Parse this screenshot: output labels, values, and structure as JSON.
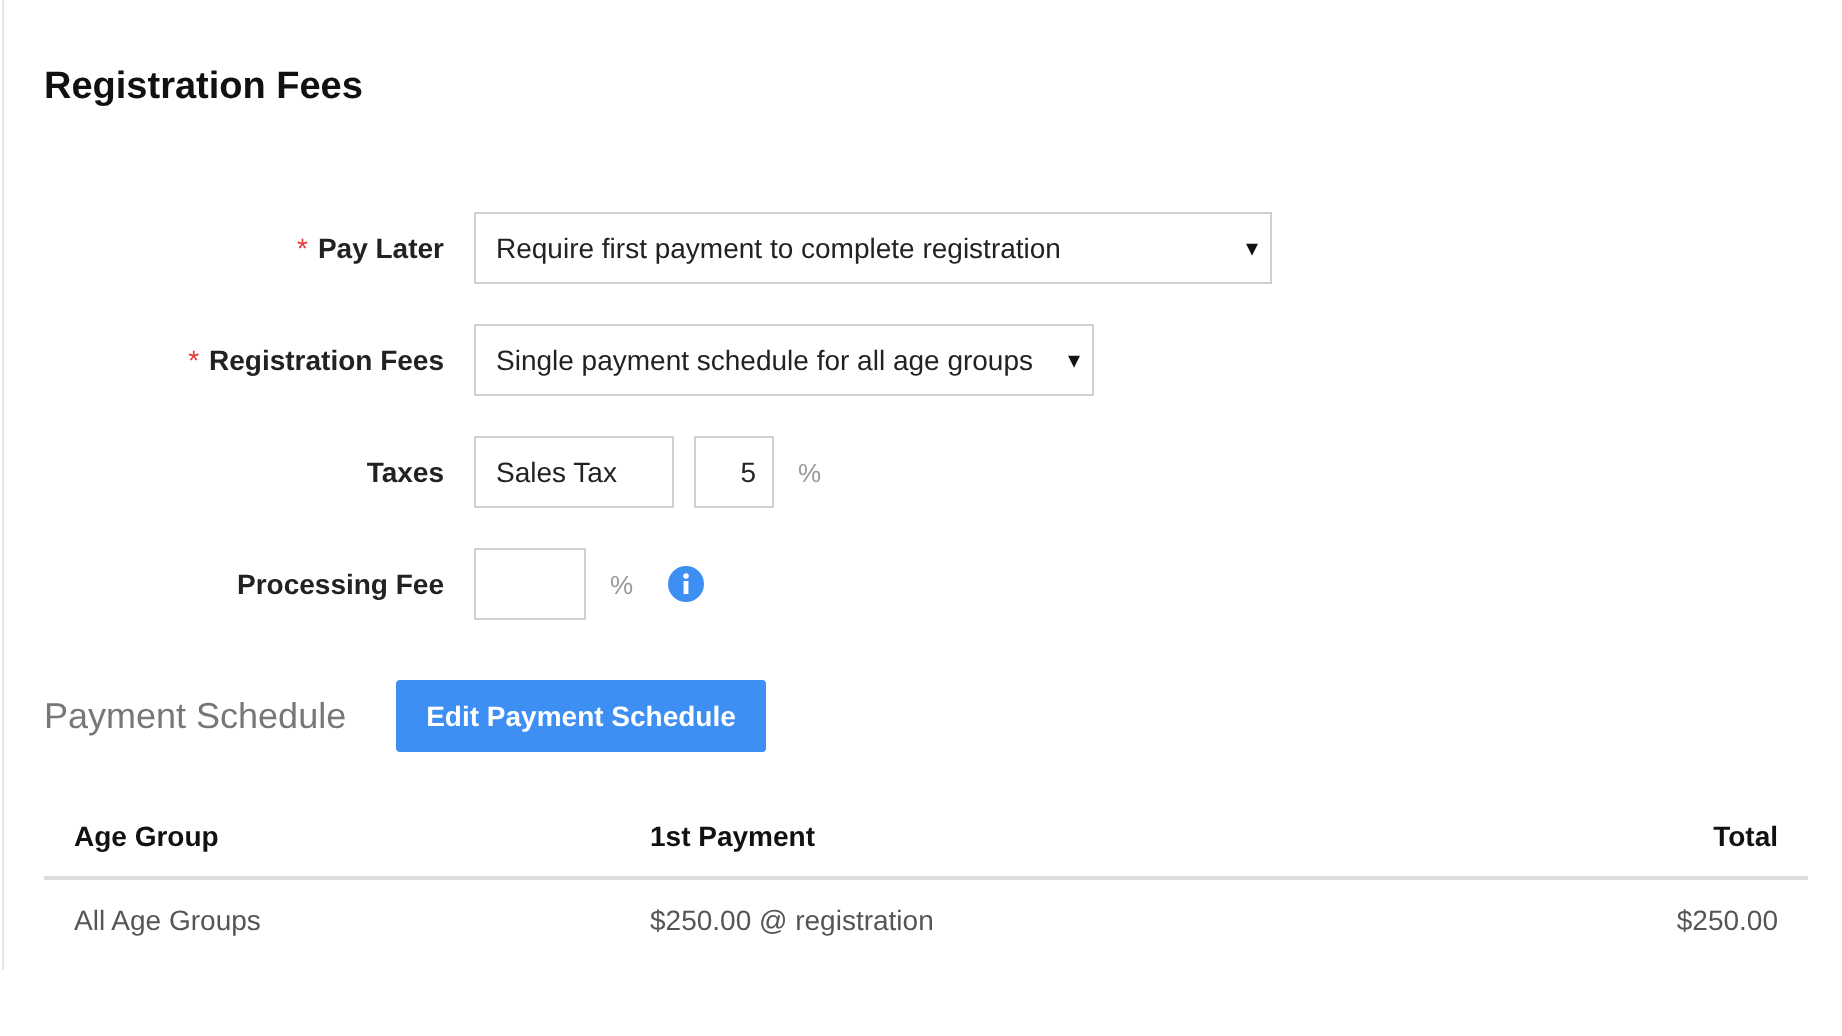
{
  "title": "Registration Fees",
  "fields": [
    {
      "kind": "select",
      "label": "Pay Later",
      "required": true,
      "value": "Require first payment to complete registration",
      "arrow": "▾"
    },
    {
      "kind": "select",
      "label": "Registration Fees",
      "required": true,
      "value": "Single payment schedule for all age groups",
      "arrow": "▾"
    },
    {
      "kind": "tax",
      "label": "Taxes",
      "required": false,
      "value": "Sales Tax",
      "rate": "5",
      "unit": "%"
    },
    {
      "kind": "percent",
      "label": "Processing Fee",
      "required": false,
      "unit": "%",
      "info": true
    }
  ],
  "required_mark": "*",
  "payment_schedule": {
    "heading": "Payment Schedule",
    "button": "Edit Payment Schedule",
    "columns": [
      "Age Group",
      "1st Payment",
      "Total"
    ],
    "rows": [
      [
        "All Age Groups",
        "$250.00 @ registration",
        "$250.00"
      ]
    ]
  }
}
